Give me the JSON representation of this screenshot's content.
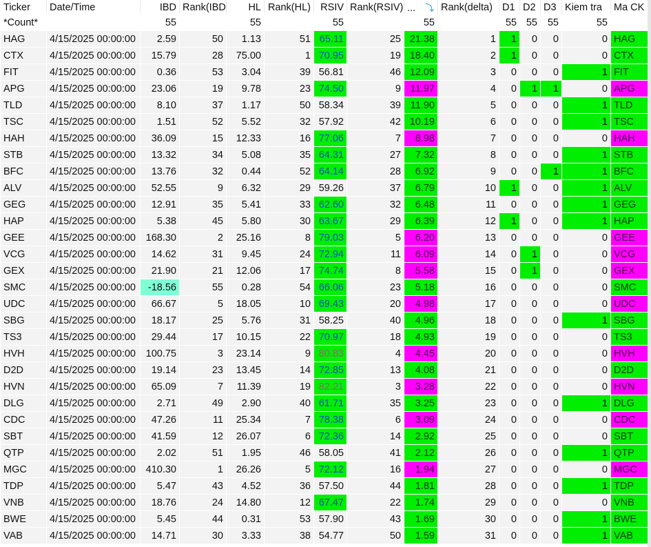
{
  "columns": [
    "Ticker",
    "Date/Time",
    "IBD",
    "Rank(IBD)",
    "HL",
    "Rank(HL)",
    "RSIV",
    "Rank(RSIV)",
    "...",
    "Rank(delta)",
    "D1",
    "D2",
    "D3",
    "Kiem tra",
    "Ma CK"
  ],
  "sort_icon": "sort-descending-arrow-icon",
  "count_row": {
    "label": "*Count*",
    "ibd": "55",
    "hl": "55",
    "rsiv": "55",
    "delta": "55",
    "d1": "55",
    "d2": "55",
    "d3": "55",
    "kiem_tra": "55"
  },
  "colors": {
    "green": "#00ee00",
    "magenta": "#ff00ff",
    "cyan": "#7fffd4",
    "rsiv_text": "#1050c0"
  },
  "rows": [
    {
      "ticker": "HAG",
      "date": "4/15/2025 00:00:00",
      "ibd": "2.59",
      "rank_ibd": "50",
      "hl": "1.13",
      "rank_hl": "51",
      "rsiv": "65.11",
      "rank_rsiv": "25",
      "delta": "21.38",
      "rank_delta": "1",
      "d1": "1",
      "d2": "0",
      "d3": "0",
      "kiem_tra": "0",
      "ma_ck": "HAG",
      "tag": "g"
    },
    {
      "ticker": "CTX",
      "date": "4/15/2025 00:00:00",
      "ibd": "15.79",
      "rank_ibd": "28",
      "hl": "75.00",
      "rank_hl": "1",
      "rsiv": "70.95",
      "rank_rsiv": "19",
      "delta": "18.40",
      "rank_delta": "2",
      "d1": "1",
      "d2": "0",
      "d3": "0",
      "kiem_tra": "0",
      "ma_ck": "CTX",
      "tag": "g"
    },
    {
      "ticker": "FIT",
      "date": "4/15/2025 00:00:00",
      "ibd": "0.36",
      "rank_ibd": "53",
      "hl": "3.04",
      "rank_hl": "39",
      "rsiv": "56.81",
      "rank_rsiv": "46",
      "delta": "12.09",
      "rank_delta": "3",
      "d1": "0",
      "d2": "0",
      "d3": "0",
      "kiem_tra": "1",
      "ma_ck": "FIT",
      "tag": "g"
    },
    {
      "ticker": "APG",
      "date": "4/15/2025 00:00:00",
      "ibd": "23.06",
      "rank_ibd": "19",
      "hl": "9.78",
      "rank_hl": "23",
      "rsiv": "74.50",
      "rank_rsiv": "9",
      "delta": "11.97",
      "rank_delta": "4",
      "d1": "0",
      "d2": "1",
      "d3": "1",
      "kiem_tra": "0",
      "ma_ck": "APG",
      "tag": "m"
    },
    {
      "ticker": "TLD",
      "date": "4/15/2025 00:00:00",
      "ibd": "8.10",
      "rank_ibd": "37",
      "hl": "1.17",
      "rank_hl": "50",
      "rsiv": "58.34",
      "rank_rsiv": "39",
      "delta": "11.90",
      "rank_delta": "5",
      "d1": "0",
      "d2": "0",
      "d3": "0",
      "kiem_tra": "1",
      "ma_ck": "TLD",
      "tag": "g"
    },
    {
      "ticker": "TSC",
      "date": "4/15/2025 00:00:00",
      "ibd": "1.51",
      "rank_ibd": "52",
      "hl": "5.52",
      "rank_hl": "32",
      "rsiv": "57.92",
      "rank_rsiv": "42",
      "delta": "10.19",
      "rank_delta": "6",
      "d1": "0",
      "d2": "0",
      "d3": "0",
      "kiem_tra": "1",
      "ma_ck": "TSC",
      "tag": "g"
    },
    {
      "ticker": "HAH",
      "date": "4/15/2025 00:00:00",
      "ibd": "36.09",
      "rank_ibd": "15",
      "hl": "12.33",
      "rank_hl": "16",
      "rsiv": "77.06",
      "rank_rsiv": "7",
      "delta": "8.98",
      "rank_delta": "7",
      "d1": "0",
      "d2": "0",
      "d3": "0",
      "kiem_tra": "0",
      "ma_ck": "HAH",
      "tag": "m"
    },
    {
      "ticker": "STB",
      "date": "4/15/2025 00:00:00",
      "ibd": "13.32",
      "rank_ibd": "34",
      "hl": "5.08",
      "rank_hl": "35",
      "rsiv": "64.31",
      "rank_rsiv": "27",
      "delta": "7.32",
      "rank_delta": "8",
      "d1": "0",
      "d2": "0",
      "d3": "0",
      "kiem_tra": "1",
      "ma_ck": "STB",
      "tag": "g"
    },
    {
      "ticker": "BFC",
      "date": "4/15/2025 00:00:00",
      "ibd": "13.76",
      "rank_ibd": "32",
      "hl": "0.44",
      "rank_hl": "52",
      "rsiv": "64.14",
      "rank_rsiv": "28",
      "delta": "6.92",
      "rank_delta": "9",
      "d1": "0",
      "d2": "0",
      "d3": "1",
      "kiem_tra": "1",
      "ma_ck": "BFC",
      "tag": "g"
    },
    {
      "ticker": "ALV",
      "date": "4/15/2025 00:00:00",
      "ibd": "52.55",
      "rank_ibd": "9",
      "hl": "6.32",
      "rank_hl": "29",
      "rsiv": "59.26",
      "rank_rsiv": "37",
      "delta": "6.79",
      "rank_delta": "10",
      "d1": "1",
      "d2": "0",
      "d3": "0",
      "kiem_tra": "1",
      "ma_ck": "ALV",
      "tag": "g"
    },
    {
      "ticker": "GEG",
      "date": "4/15/2025 00:00:00",
      "ibd": "12.91",
      "rank_ibd": "35",
      "hl": "5.41",
      "rank_hl": "33",
      "rsiv": "62.60",
      "rank_rsiv": "32",
      "delta": "6.48",
      "rank_delta": "11",
      "d1": "0",
      "d2": "0",
      "d3": "0",
      "kiem_tra": "1",
      "ma_ck": "GEG",
      "tag": "g"
    },
    {
      "ticker": "HAP",
      "date": "4/15/2025 00:00:00",
      "ibd": "5.38",
      "rank_ibd": "45",
      "hl": "5.80",
      "rank_hl": "30",
      "rsiv": "63.67",
      "rank_rsiv": "29",
      "delta": "6.39",
      "rank_delta": "12",
      "d1": "1",
      "d2": "0",
      "d3": "0",
      "kiem_tra": "1",
      "ma_ck": "HAP",
      "tag": "g"
    },
    {
      "ticker": "GEE",
      "date": "4/15/2025 00:00:00",
      "ibd": "168.30",
      "rank_ibd": "2",
      "hl": "25.16",
      "rank_hl": "8",
      "rsiv": "79.03",
      "rank_rsiv": "5",
      "delta": "6.20",
      "rank_delta": "13",
      "d1": "0",
      "d2": "0",
      "d3": "0",
      "kiem_tra": "0",
      "ma_ck": "GEE",
      "tag": "m"
    },
    {
      "ticker": "VCG",
      "date": "4/15/2025 00:00:00",
      "ibd": "14.62",
      "rank_ibd": "31",
      "hl": "9.45",
      "rank_hl": "24",
      "rsiv": "72.94",
      "rank_rsiv": "11",
      "delta": "6.09",
      "rank_delta": "14",
      "d1": "0",
      "d2": "1",
      "d3": "0",
      "kiem_tra": "0",
      "ma_ck": "VCG",
      "tag": "m"
    },
    {
      "ticker": "GEX",
      "date": "4/15/2025 00:00:00",
      "ibd": "21.90",
      "rank_ibd": "21",
      "hl": "12.06",
      "rank_hl": "17",
      "rsiv": "74.74",
      "rank_rsiv": "8",
      "delta": "5.58",
      "rank_delta": "15",
      "d1": "0",
      "d2": "1",
      "d3": "0",
      "kiem_tra": "0",
      "ma_ck": "GEX",
      "tag": "m"
    },
    {
      "ticker": "SMC",
      "date": "4/15/2025 00:00:00",
      "ibd": "-18.56",
      "rank_ibd": "55",
      "hl": "0.28",
      "rank_hl": "54",
      "rsiv": "66.06",
      "rank_rsiv": "23",
      "delta": "5.18",
      "rank_delta": "16",
      "d1": "0",
      "d2": "0",
      "d3": "0",
      "kiem_tra": "0",
      "ma_ck": "SMC",
      "tag": "g"
    },
    {
      "ticker": "UDC",
      "date": "4/15/2025 00:00:00",
      "ibd": "66.67",
      "rank_ibd": "5",
      "hl": "18.05",
      "rank_hl": "10",
      "rsiv": "69.43",
      "rank_rsiv": "20",
      "delta": "4.98",
      "rank_delta": "17",
      "d1": "0",
      "d2": "0",
      "d3": "0",
      "kiem_tra": "0",
      "ma_ck": "UDC",
      "tag": "m"
    },
    {
      "ticker": "SBG",
      "date": "4/15/2025 00:00:00",
      "ibd": "18.17",
      "rank_ibd": "25",
      "hl": "5.76",
      "rank_hl": "31",
      "rsiv": "58.25",
      "rank_rsiv": "40",
      "delta": "4.96",
      "rank_delta": "18",
      "d1": "0",
      "d2": "0",
      "d3": "0",
      "kiem_tra": "1",
      "ma_ck": "SBG",
      "tag": "g"
    },
    {
      "ticker": "TS3",
      "date": "4/15/2025 00:00:00",
      "ibd": "29.44",
      "rank_ibd": "17",
      "hl": "10.15",
      "rank_hl": "22",
      "rsiv": "70.97",
      "rank_rsiv": "18",
      "delta": "4.93",
      "rank_delta": "19",
      "d1": "0",
      "d2": "0",
      "d3": "0",
      "kiem_tra": "0",
      "ma_ck": "TS3",
      "tag": "g"
    },
    {
      "ticker": "HVH",
      "date": "4/15/2025 00:00:00",
      "ibd": "100.75",
      "rank_ibd": "3",
      "hl": "23.14",
      "rank_hl": "9",
      "rsiv": "80.83",
      "rank_rsiv": "4",
      "delta": "4.45",
      "rank_delta": "20",
      "d1": "0",
      "d2": "0",
      "d3": "0",
      "kiem_tra": "0",
      "ma_ck": "HVH",
      "tag": "m"
    },
    {
      "ticker": "D2D",
      "date": "4/15/2025 00:00:00",
      "ibd": "19.14",
      "rank_ibd": "23",
      "hl": "13.45",
      "rank_hl": "14",
      "rsiv": "72.85",
      "rank_rsiv": "13",
      "delta": "4.08",
      "rank_delta": "21",
      "d1": "0",
      "d2": "0",
      "d3": "0",
      "kiem_tra": "0",
      "ma_ck": "D2D",
      "tag": "g"
    },
    {
      "ticker": "HVN",
      "date": "4/15/2025 00:00:00",
      "ibd": "65.09",
      "rank_ibd": "7",
      "hl": "11.39",
      "rank_hl": "19",
      "rsiv": "82.21",
      "rank_rsiv": "3",
      "delta": "3.28",
      "rank_delta": "22",
      "d1": "0",
      "d2": "0",
      "d3": "0",
      "kiem_tra": "0",
      "ma_ck": "HVN",
      "tag": "m"
    },
    {
      "ticker": "DLG",
      "date": "4/15/2025 00:00:00",
      "ibd": "2.71",
      "rank_ibd": "49",
      "hl": "2.90",
      "rank_hl": "40",
      "rsiv": "61.71",
      "rank_rsiv": "35",
      "delta": "3.25",
      "rank_delta": "23",
      "d1": "0",
      "d2": "0",
      "d3": "0",
      "kiem_tra": "1",
      "ma_ck": "DLG",
      "tag": "g"
    },
    {
      "ticker": "CDC",
      "date": "4/15/2025 00:00:00",
      "ibd": "47.26",
      "rank_ibd": "11",
      "hl": "25.34",
      "rank_hl": "7",
      "rsiv": "78.38",
      "rank_rsiv": "6",
      "delta": "3.09",
      "rank_delta": "24",
      "d1": "0",
      "d2": "0",
      "d3": "0",
      "kiem_tra": "0",
      "ma_ck": "CDC",
      "tag": "m"
    },
    {
      "ticker": "SBT",
      "date": "4/15/2025 00:00:00",
      "ibd": "41.59",
      "rank_ibd": "12",
      "hl": "26.07",
      "rank_hl": "6",
      "rsiv": "72.36",
      "rank_rsiv": "14",
      "delta": "2.92",
      "rank_delta": "25",
      "d1": "0",
      "d2": "0",
      "d3": "0",
      "kiem_tra": "0",
      "ma_ck": "SBT",
      "tag": "g"
    },
    {
      "ticker": "QTP",
      "date": "4/15/2025 00:00:00",
      "ibd": "2.02",
      "rank_ibd": "51",
      "hl": "1.95",
      "rank_hl": "46",
      "rsiv": "58.05",
      "rank_rsiv": "41",
      "delta": "2.12",
      "rank_delta": "26",
      "d1": "0",
      "d2": "0",
      "d3": "0",
      "kiem_tra": "1",
      "ma_ck": "QTP",
      "tag": "g"
    },
    {
      "ticker": "MGC",
      "date": "4/15/2025 00:00:00",
      "ibd": "410.30",
      "rank_ibd": "1",
      "hl": "26.26",
      "rank_hl": "5",
      "rsiv": "72.12",
      "rank_rsiv": "16",
      "delta": "1.94",
      "rank_delta": "27",
      "d1": "0",
      "d2": "0",
      "d3": "0",
      "kiem_tra": "0",
      "ma_ck": "MGC",
      "tag": "m"
    },
    {
      "ticker": "TDP",
      "date": "4/15/2025 00:00:00",
      "ibd": "5.47",
      "rank_ibd": "43",
      "hl": "4.52",
      "rank_hl": "36",
      "rsiv": "57.50",
      "rank_rsiv": "44",
      "delta": "1.81",
      "rank_delta": "28",
      "d1": "0",
      "d2": "0",
      "d3": "0",
      "kiem_tra": "1",
      "ma_ck": "TDP",
      "tag": "g"
    },
    {
      "ticker": "VNB",
      "date": "4/15/2025 00:00:00",
      "ibd": "18.76",
      "rank_ibd": "24",
      "hl": "14.80",
      "rank_hl": "12",
      "rsiv": "67.47",
      "rank_rsiv": "22",
      "delta": "1.74",
      "rank_delta": "29",
      "d1": "0",
      "d2": "0",
      "d3": "0",
      "kiem_tra": "0",
      "ma_ck": "VNB",
      "tag": "g"
    },
    {
      "ticker": "BWE",
      "date": "4/15/2025 00:00:00",
      "ibd": "5.45",
      "rank_ibd": "44",
      "hl": "0.31",
      "rank_hl": "53",
      "rsiv": "57.90",
      "rank_rsiv": "43",
      "delta": "1.69",
      "rank_delta": "30",
      "d1": "0",
      "d2": "0",
      "d3": "0",
      "kiem_tra": "1",
      "ma_ck": "BWE",
      "tag": "g"
    },
    {
      "ticker": "VAB",
      "date": "4/15/2025 00:00:00",
      "ibd": "14.71",
      "rank_ibd": "30",
      "hl": "3.33",
      "rank_hl": "38",
      "rsiv": "54.77",
      "rank_rsiv": "50",
      "delta": "1.59",
      "rank_delta": "31",
      "d1": "0",
      "d2": "0",
      "d3": "0",
      "kiem_tra": "1",
      "ma_ck": "VAB",
      "tag": "g"
    }
  ]
}
